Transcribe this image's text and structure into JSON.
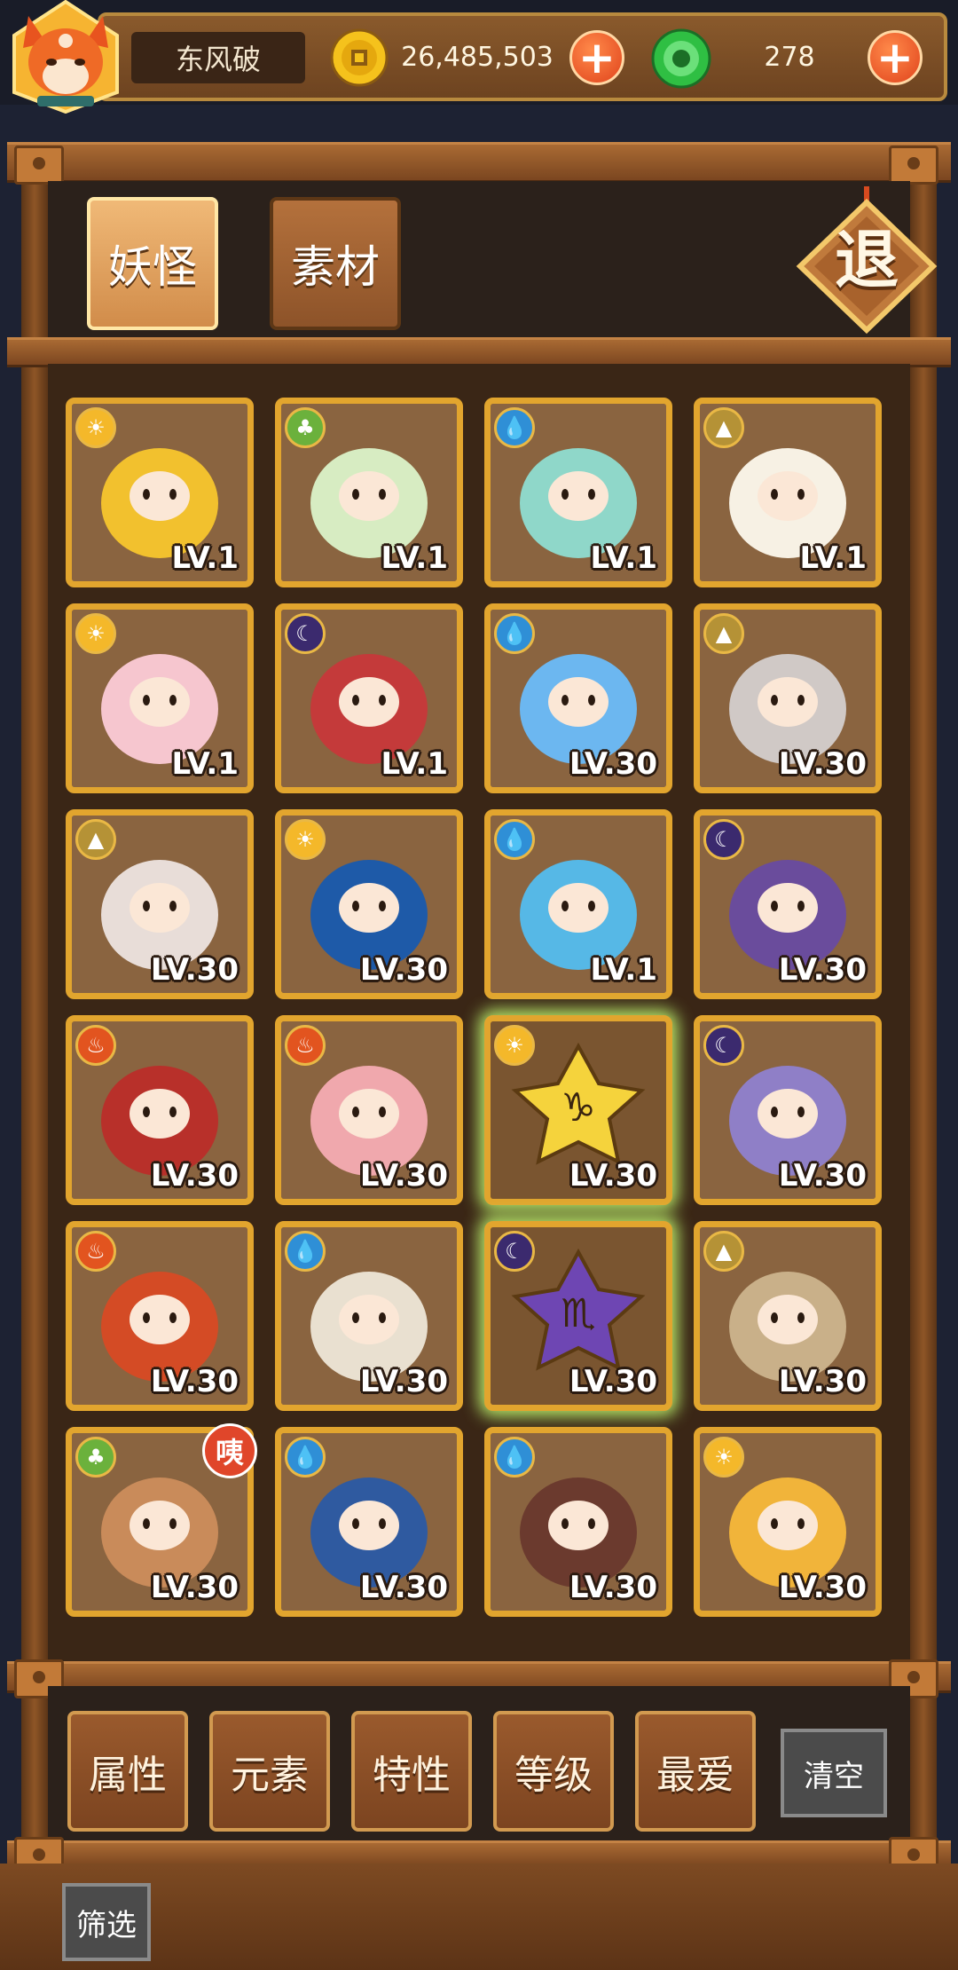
{
  "header": {
    "player_name": "东风破",
    "coins": "26,485,503",
    "gems": "278",
    "coin_icon": "gold-coin-icon",
    "gem_icon": "green-gem-icon",
    "add_icon": "plus-icon"
  },
  "tabs": [
    {
      "label": "妖怪",
      "active": true
    },
    {
      "label": "素材",
      "active": false
    }
  ],
  "exit_label": "退",
  "element_colors": {
    "light": "#f4b82a",
    "nature": "#6bb13c",
    "water": "#2f8fd6",
    "earth": "#b59236",
    "dark": "#3b2a6e",
    "fire": "#e2541f"
  },
  "monsters": [
    {
      "element": "light",
      "level": "LV.1",
      "color": "#f2c12e"
    },
    {
      "element": "nature",
      "level": "LV.1",
      "color": "#d7ecc2"
    },
    {
      "element": "water",
      "level": "LV.1",
      "color": "#8fd7c9"
    },
    {
      "element": "earth",
      "level": "LV.1",
      "color": "#f7f1e4"
    },
    {
      "element": "light",
      "level": "LV.1",
      "color": "#f6c6cf"
    },
    {
      "element": "dark",
      "level": "LV.1",
      "color": "#c43a3a"
    },
    {
      "element": "water",
      "level": "LV.30",
      "color": "#6cb7f0"
    },
    {
      "element": "earth",
      "level": "LV.30",
      "color": "#d0c9c6"
    },
    {
      "element": "earth",
      "level": "LV.30",
      "color": "#e8ddd8"
    },
    {
      "element": "light",
      "level": "LV.30",
      "color": "#1e5aa8"
    },
    {
      "element": "water",
      "level": "LV.1",
      "color": "#56b8e6"
    },
    {
      "element": "dark",
      "level": "LV.30",
      "color": "#6a4c9c"
    },
    {
      "element": "fire",
      "level": "LV.30",
      "color": "#b8302a"
    },
    {
      "element": "fire",
      "level": "LV.30",
      "color": "#f0a8ad"
    },
    {
      "element": "light",
      "level": "LV.30",
      "color": "#f5d33c",
      "selected": true,
      "glyph": "♑"
    },
    {
      "element": "dark",
      "level": "LV.30",
      "color": "#8f7fc7"
    },
    {
      "element": "fire",
      "level": "LV.30",
      "color": "#d44b25"
    },
    {
      "element": "water",
      "level": "LV.30",
      "color": "#e9e0d0"
    },
    {
      "element": "dark",
      "level": "LV.30",
      "color": "#6e46b3",
      "selected": true,
      "glyph": "♏"
    },
    {
      "element": "earth",
      "level": "LV.30",
      "color": "#c9b089"
    },
    {
      "element": "nature",
      "level": "LV.30",
      "color": "#c98b5a",
      "badge": "咦"
    },
    {
      "element": "water",
      "level": "LV.30",
      "color": "#2f5aa0"
    },
    {
      "element": "water",
      "level": "LV.30",
      "color": "#6b3a2e"
    },
    {
      "element": "light",
      "level": "LV.30",
      "color": "#f1b43a"
    }
  ],
  "filters": [
    "属性",
    "元素",
    "特性",
    "等级",
    "最爱"
  ],
  "clear_label": "清空",
  "screen_label": "筛选"
}
